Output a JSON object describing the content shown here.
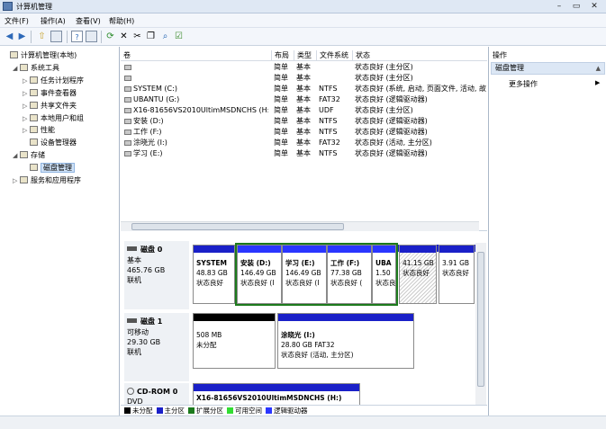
{
  "window": {
    "title": "计算机管理",
    "min": "–",
    "max": "▭",
    "close": "✕"
  },
  "menu": [
    "文件(F)",
    "操作(A)",
    "查看(V)",
    "帮助(H)"
  ],
  "toolbar_icons": [
    "back-icon",
    "forward-icon",
    "up-icon",
    "show-hide-tree-icon",
    "help-icon",
    "properties-icon",
    "refresh-icon",
    "delete-icon",
    "cut-icon",
    "copy-icon",
    "search-icon",
    "check-icon"
  ],
  "tree": [
    {
      "label": "计算机管理(本地)",
      "level": 0,
      "expander": "",
      "icon": "computer-icon"
    },
    {
      "label": "系统工具",
      "level": 1,
      "expander": "◢",
      "icon": "tools-icon"
    },
    {
      "label": "任务计划程序",
      "level": 2,
      "expander": "▷",
      "icon": "clock-icon"
    },
    {
      "label": "事件查看器",
      "level": 2,
      "expander": "▷",
      "icon": "event-icon"
    },
    {
      "label": "共享文件夹",
      "level": 2,
      "expander": "▷",
      "icon": "folder-icon"
    },
    {
      "label": "本地用户和组",
      "level": 2,
      "expander": "▷",
      "icon": "users-icon"
    },
    {
      "label": "性能",
      "level": 2,
      "expander": "▷",
      "icon": "performance-icon"
    },
    {
      "label": "设备管理器",
      "level": 2,
      "expander": "",
      "icon": "device-icon"
    },
    {
      "label": "存储",
      "level": 1,
      "expander": "◢",
      "icon": "storage-icon"
    },
    {
      "label": "磁盘管理",
      "level": 2,
      "expander": "",
      "icon": "disk-icon",
      "selected": true
    },
    {
      "label": "服务和应用程序",
      "level": 1,
      "expander": "▷",
      "icon": "services-icon"
    }
  ],
  "columns": [
    "卷",
    "布局",
    "类型",
    "文件系统",
    "状态"
  ],
  "volumes": [
    {
      "name": "",
      "layout": "简单",
      "type": "基本",
      "fs": "",
      "status": "状态良好 (主分区)"
    },
    {
      "name": "",
      "layout": "简单",
      "type": "基本",
      "fs": "",
      "status": "状态良好 (主分区)"
    },
    {
      "name": "SYSTEM (C:)",
      "layout": "简单",
      "type": "基本",
      "fs": "NTFS",
      "status": "状态良好 (系统, 启动, 页面文件, 活动, 故"
    },
    {
      "name": "UBANTU (G:)",
      "layout": "简单",
      "type": "基本",
      "fs": "FAT32",
      "status": "状态良好 (逻辑驱动器)"
    },
    {
      "name": "X16-81656VS2010UltimMSDNCHS (H:)",
      "layout": "简单",
      "type": "基本",
      "fs": "UDF",
      "status": "状态良好 (主分区)"
    },
    {
      "name": "安装 (D:)",
      "layout": "简单",
      "type": "基本",
      "fs": "NTFS",
      "status": "状态良好 (逻辑驱动器)"
    },
    {
      "name": "工作 (F:)",
      "layout": "简单",
      "type": "基本",
      "fs": "NTFS",
      "status": "状态良好 (逻辑驱动器)"
    },
    {
      "name": "涂晓光 (I:)",
      "layout": "简单",
      "type": "基本",
      "fs": "FAT32",
      "status": "状态良好 (活动, 主分区)"
    },
    {
      "name": "学习 (E:)",
      "layout": "简单",
      "type": "基本",
      "fs": "NTFS",
      "status": "状态良好 (逻辑驱动器)"
    }
  ],
  "disk0": {
    "name": "磁盘 0",
    "type": "基本",
    "size": "465.76 GB",
    "status": "联机",
    "parts": [
      {
        "label": "SYSTEM",
        "size": "48.83 GB",
        "status": "状态良好"
      },
      {
        "label": "安装 (D:)",
        "size": "146.49 GB",
        "status": "状态良好 (I"
      },
      {
        "label": "学习 (E:)",
        "size": "146.49 GB",
        "status": "状态良好 (I"
      },
      {
        "label": "工作 (F:)",
        "size": "77.38 GB",
        "status": "状态良好 ("
      },
      {
        "label": "UBA",
        "size": "1.50",
        "status": "状态良"
      },
      {
        "label": "",
        "size": "41.15 GB",
        "status": "状态良好"
      },
      {
        "label": "",
        "size": "3.91 GB",
        "status": "状态良好"
      }
    ]
  },
  "disk1": {
    "name": "磁盘 1",
    "type": "可移动",
    "size": "29.30 GB",
    "status": "联机",
    "parts": [
      {
        "label": "",
        "size": "508 MB",
        "status": "未分配"
      },
      {
        "label": "涂晓光 (I:)",
        "size": "28.80 GB FAT32",
        "status": "状态良好 (活动, 主分区)"
      }
    ]
  },
  "cdrom": {
    "name": "CD-ROM 0",
    "type": "DVD",
    "part_label": "X16-81656VS2010UltimMSDNCHS (H:)"
  },
  "legend": [
    {
      "label": "未分配",
      "color": "#000000"
    },
    {
      "label": "主分区",
      "color": "#1a20c8"
    },
    {
      "label": "扩展分区",
      "color": "#1c7a1c"
    },
    {
      "label": "可用空间",
      "color": "#33dd33"
    },
    {
      "label": "逻辑驱动器",
      "color": "#2a36ff"
    }
  ],
  "actions": {
    "header": "操作",
    "section": "磁盘管理",
    "more": "更多操作",
    "more_arrow": "▶",
    "collapse": "▲"
  }
}
